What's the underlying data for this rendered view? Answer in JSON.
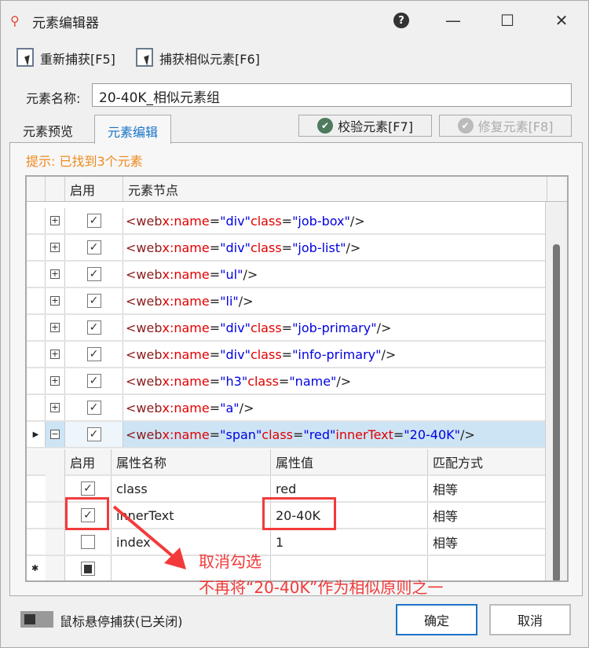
{
  "window": {
    "title": "元素编辑器",
    "help": "?",
    "minimize": "—",
    "maximize": "☐",
    "close": "✕"
  },
  "toolbar": {
    "recapture": "重新捕获[F5]",
    "capture_similar": "捕获相似元素[F6]"
  },
  "name_field": {
    "label": "元素名称:",
    "value": "20-40K_相似元素组"
  },
  "tabs": [
    {
      "label": "元素预览"
    },
    {
      "label": "元素编辑"
    }
  ],
  "actions": {
    "verify": "校验元素[F7]",
    "repair": "修复元素[F8]"
  },
  "hint": "提示: 已找到3个元素",
  "grid": {
    "headers": {
      "enable": "启用",
      "node": "元素节点"
    },
    "rows": [
      {
        "checked": true,
        "parts": [
          [
            "tag",
            "<web "
          ],
          [
            "an",
            "x:name"
          ],
          [
            "pl",
            "="
          ],
          [
            "av",
            "\"div\""
          ],
          [
            "pl",
            " "
          ],
          [
            "an",
            "class"
          ],
          [
            "pl",
            "="
          ],
          [
            "av",
            "\"job-box\""
          ],
          [
            "pl",
            " />"
          ]
        ]
      },
      {
        "checked": true,
        "parts": [
          [
            "tag",
            "<web "
          ],
          [
            "an",
            "x:name"
          ],
          [
            "pl",
            "="
          ],
          [
            "av",
            "\"div\""
          ],
          [
            "pl",
            " "
          ],
          [
            "an",
            "class"
          ],
          [
            "pl",
            "="
          ],
          [
            "av",
            "\"job-list\""
          ],
          [
            "pl",
            " />"
          ]
        ]
      },
      {
        "checked": true,
        "parts": [
          [
            "tag",
            "<web "
          ],
          [
            "an",
            "x:name"
          ],
          [
            "pl",
            "="
          ],
          [
            "av",
            "\"ul\""
          ],
          [
            "pl",
            " />"
          ]
        ]
      },
      {
        "checked": true,
        "parts": [
          [
            "tag",
            "<web "
          ],
          [
            "an",
            "x:name"
          ],
          [
            "pl",
            "="
          ],
          [
            "av",
            "\"li\""
          ],
          [
            "pl",
            " />"
          ]
        ]
      },
      {
        "checked": true,
        "parts": [
          [
            "tag",
            "<web "
          ],
          [
            "an",
            "x:name"
          ],
          [
            "pl",
            "="
          ],
          [
            "av",
            "\"div\""
          ],
          [
            "pl",
            " "
          ],
          [
            "an",
            "class"
          ],
          [
            "pl",
            "="
          ],
          [
            "av",
            "\"job-primary\""
          ],
          [
            "pl",
            " />"
          ]
        ]
      },
      {
        "checked": true,
        "parts": [
          [
            "tag",
            "<web "
          ],
          [
            "an",
            "x:name"
          ],
          [
            "pl",
            "="
          ],
          [
            "av",
            "\"div\""
          ],
          [
            "pl",
            " "
          ],
          [
            "an",
            "class"
          ],
          [
            "pl",
            "="
          ],
          [
            "av",
            "\"info-primary\""
          ],
          [
            "pl",
            " />"
          ]
        ]
      },
      {
        "checked": true,
        "parts": [
          [
            "tag",
            "<web "
          ],
          [
            "an",
            "x:name"
          ],
          [
            "pl",
            "="
          ],
          [
            "av",
            "\"h3\""
          ],
          [
            "pl",
            " "
          ],
          [
            "an",
            "class"
          ],
          [
            "pl",
            "="
          ],
          [
            "av",
            "\"name\""
          ],
          [
            "pl",
            " />"
          ]
        ]
      },
      {
        "checked": true,
        "parts": [
          [
            "tag",
            "<web "
          ],
          [
            "an",
            "x:name"
          ],
          [
            "pl",
            "="
          ],
          [
            "av",
            "\"a\""
          ],
          [
            "pl",
            " />"
          ]
        ]
      },
      {
        "checked": true,
        "selected": true,
        "expanded": true,
        "parts": [
          [
            "tag",
            "<web "
          ],
          [
            "an",
            "x:name"
          ],
          [
            "pl",
            "="
          ],
          [
            "av",
            "\"span\""
          ],
          [
            "pl",
            " "
          ],
          [
            "an",
            "class"
          ],
          [
            "pl",
            "="
          ],
          [
            "av",
            "\"red\""
          ],
          [
            "pl",
            " "
          ],
          [
            "an",
            "innerText"
          ],
          [
            "pl",
            "="
          ],
          [
            "av",
            "\"20-40K\""
          ],
          [
            "pl",
            " />"
          ]
        ]
      }
    ],
    "attr_headers": {
      "enable": "启用",
      "name": "属性名称",
      "value": "属性值",
      "match": "匹配方式"
    },
    "attrs": [
      {
        "checked": true,
        "name": "class",
        "value": "red",
        "match": "相等"
      },
      {
        "checked": true,
        "name": "innerText",
        "value": "20-40K",
        "match": "相等",
        "highlight": true
      },
      {
        "checked": false,
        "name": "index",
        "value": "1",
        "match": "相等"
      }
    ],
    "new_row_marker": "✱"
  },
  "annotation": {
    "line1": "取消勾选",
    "line2": "不再将“20-40K”作为相似原则之一",
    "color": "#f23a3a"
  },
  "footer": {
    "hover_capture": "鼠标悬停捕获(已关闭)",
    "ok": "确定",
    "cancel": "取消"
  }
}
